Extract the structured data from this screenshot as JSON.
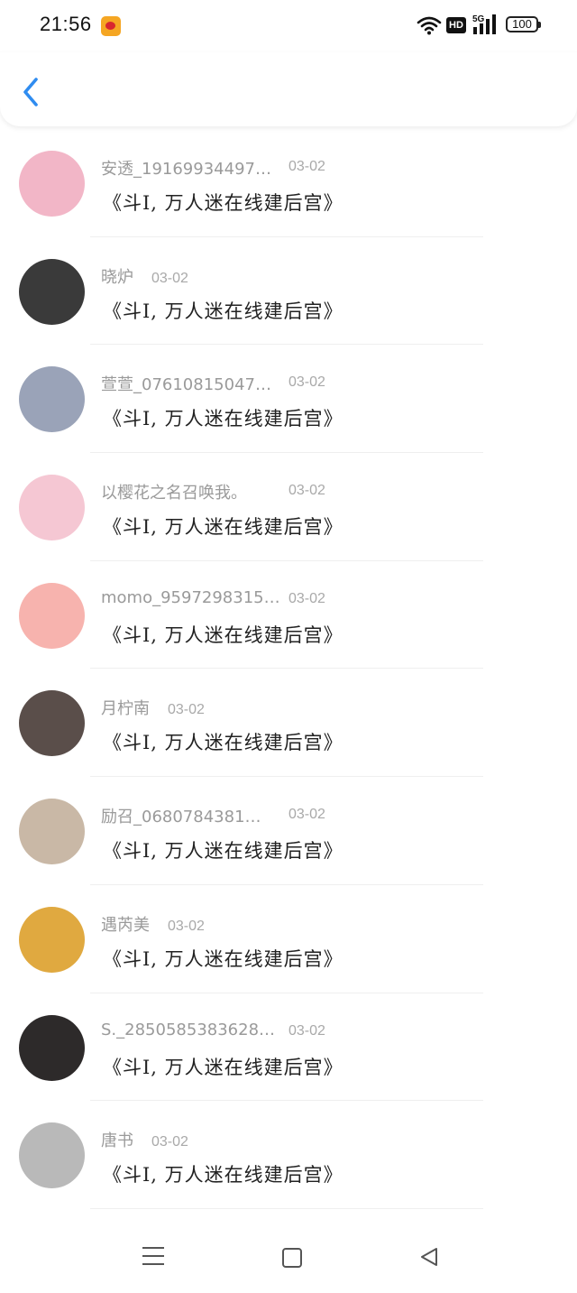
{
  "status_bar": {
    "time": "21:56",
    "hd_label": "HD",
    "network_label": "5G",
    "battery_level": "100"
  },
  "header": {
    "back_icon": "chevron-left-icon"
  },
  "message_text": "《斗I, 万人迷在线建后宫》",
  "rows": [
    {
      "name": "安透_19169934497…",
      "date": "03-02",
      "avatar_color": "#f2b6c7"
    },
    {
      "name": "晓炉",
      "date": "03-02",
      "avatar_color": "#3a3a3a"
    },
    {
      "name": "萱萱_07610815047…",
      "date": "03-02",
      "avatar_color": "#9aa3b8"
    },
    {
      "name": "以樱花之名召唤我。",
      "date": "03-02",
      "avatar_color": "#f5c7d3"
    },
    {
      "name": "momo_9597298315…",
      "date": "03-02",
      "avatar_color": "#f7b3ae"
    },
    {
      "name": "月柠南",
      "date": "03-02",
      "avatar_color": "#5a4e4a"
    },
    {
      "name": "励召_0680784381…",
      "date": "03-02",
      "avatar_color": "#c9b8a6"
    },
    {
      "name": "遇芮美",
      "date": "03-02",
      "avatar_color": "#e0a940"
    },
    {
      "name": "S._2850585383628…",
      "date": "03-02",
      "avatar_color": "#2d2a2a"
    },
    {
      "name": "唐书",
      "date": "03-02",
      "avatar_color": "#b9b9b9"
    }
  ],
  "nav": {
    "menu_icon": "menu-icon",
    "home_icon": "square-home-icon",
    "back_icon": "triangle-back-icon"
  }
}
